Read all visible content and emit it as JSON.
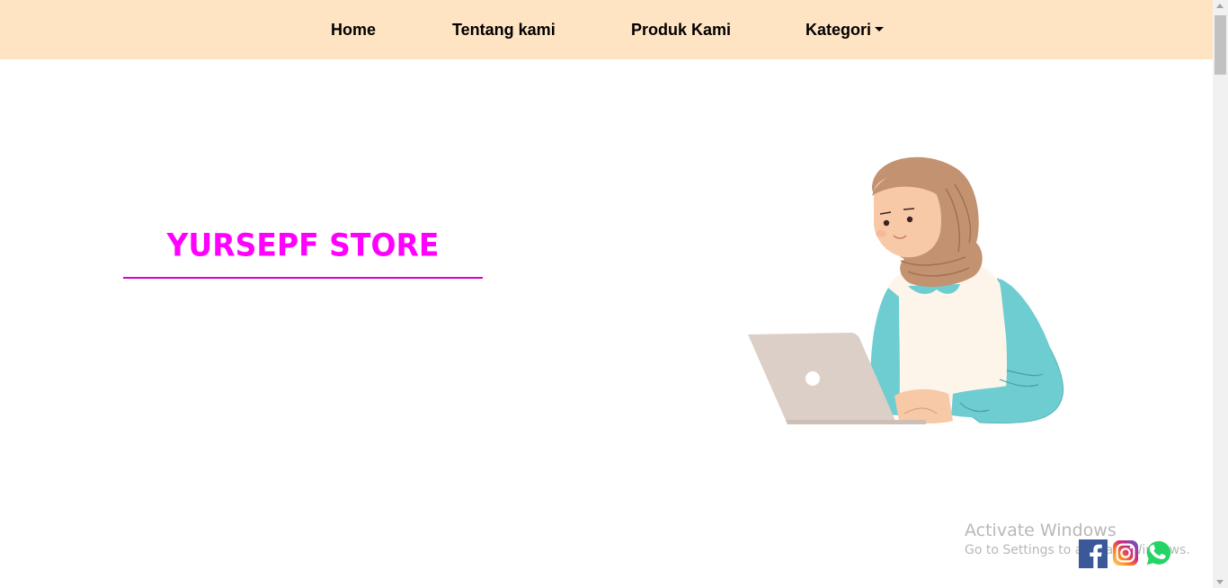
{
  "nav": {
    "home": "Home",
    "about": "Tentang kami",
    "products": "Produk Kami",
    "category": "Kategori"
  },
  "hero": {
    "title": "YURSEPF STORE"
  },
  "windows_notice": {
    "title": "Activate Windows",
    "subtitle": "Go to Settings to activate Windows."
  },
  "social": [
    "facebook-icon",
    "instagram-icon",
    "whatsapp-icon"
  ],
  "colors": {
    "navbar_bg": "#ffe4c4",
    "title": "#ff00ff",
    "underline": "#d400d4"
  }
}
